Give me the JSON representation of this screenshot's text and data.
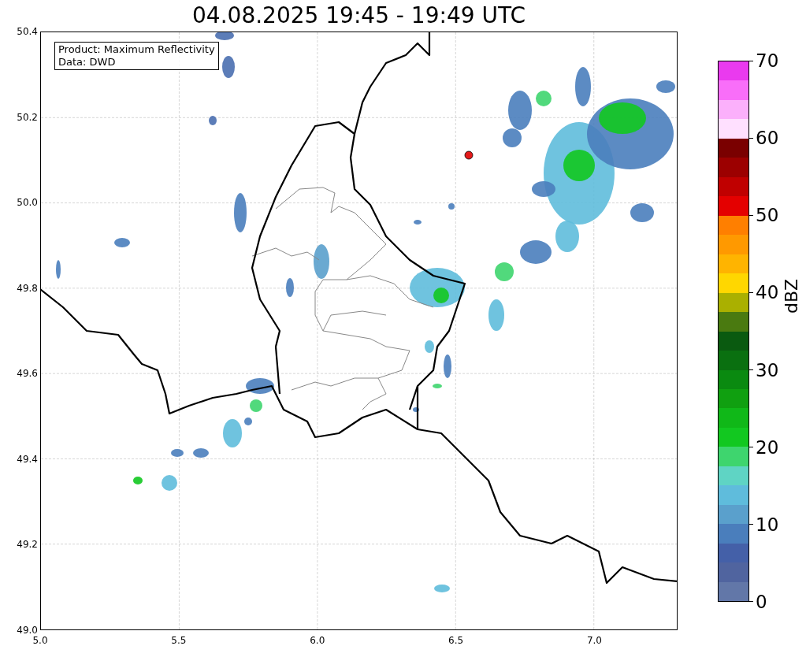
{
  "title": "04.08.2025 19:45 - 19:49 UTC",
  "info_box": [
    "Product: Maximum Reflectivity",
    "Data: DWD"
  ],
  "yticks": [
    "50.4",
    "50.2",
    "50.0",
    "49.8",
    "49.6",
    "49.4",
    "49.2",
    "49.0"
  ],
  "xticks": [
    "5.0",
    "5.5",
    "6.0",
    "6.5",
    "7.0"
  ],
  "colorbar": {
    "label": "dBZ",
    "ticks": [
      "70",
      "60",
      "50",
      "40",
      "30",
      "20",
      "10",
      "0"
    ],
    "segments": [
      {
        "color": "#ea3aef"
      },
      {
        "color": "#f96ef9"
      },
      {
        "color": "#fbb0fb"
      },
      {
        "color": "#ffe0ff"
      },
      {
        "color": "#7a0000"
      },
      {
        "color": "#9c0000"
      },
      {
        "color": "#c00000"
      },
      {
        "color": "#e40000"
      },
      {
        "color": "#ff7f00"
      },
      {
        "color": "#ff9900"
      },
      {
        "color": "#ffb400"
      },
      {
        "color": "#ffd700"
      },
      {
        "color": "#aab000"
      },
      {
        "color": "#4a7a10"
      },
      {
        "color": "#0a5a10"
      },
      {
        "color": "#0a7010"
      },
      {
        "color": "#0a8a10"
      },
      {
        "color": "#10a010"
      },
      {
        "color": "#10b818"
      },
      {
        "color": "#12c820"
      },
      {
        "color": "#3ed56e"
      },
      {
        "color": "#5fd4c4"
      },
      {
        "color": "#5fbcdc"
      },
      {
        "color": "#5aa0cc"
      },
      {
        "color": "#4a7ebc"
      },
      {
        "color": "#4460a8"
      },
      {
        "color": "#50649f"
      },
      {
        "color": "#6277a8"
      }
    ]
  }
}
